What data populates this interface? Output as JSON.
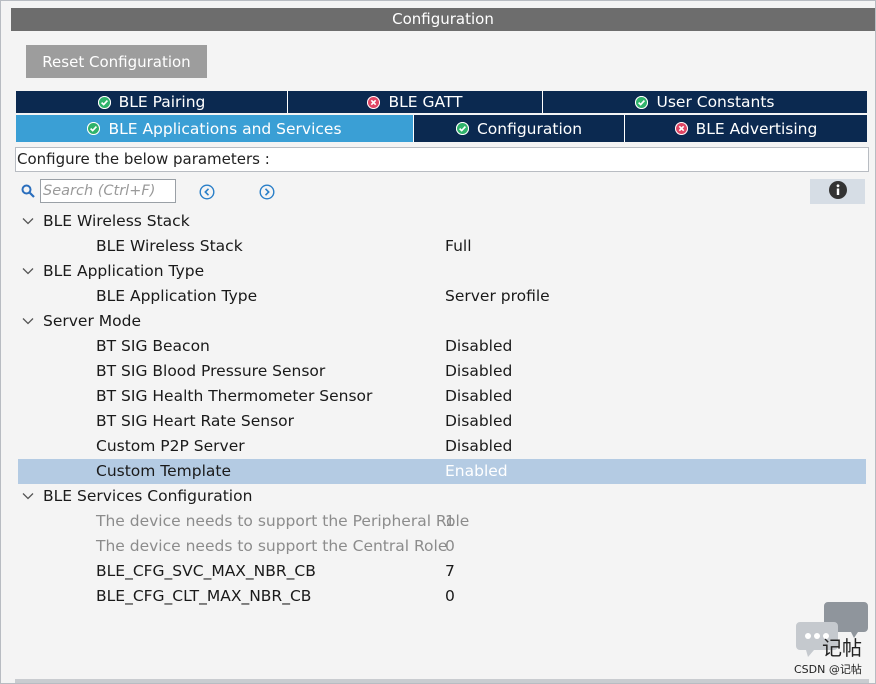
{
  "window": {
    "title": "Configuration"
  },
  "toolbar": {
    "reset_label": "Reset Configuration"
  },
  "tabs_row1": [
    {
      "label": "BLE Pairing",
      "status": "ok"
    },
    {
      "label": "BLE GATT",
      "status": "error"
    },
    {
      "label": "User Constants",
      "status": "ok"
    }
  ],
  "tabs_row2": [
    {
      "label": "BLE Applications and Services",
      "status": "ok",
      "active": true
    },
    {
      "label": "Configuration",
      "status": "ok"
    },
    {
      "label": "BLE Advertising",
      "status": "error"
    }
  ],
  "description": "Configure the below parameters :",
  "search": {
    "placeholder": "Search (Ctrl+F)"
  },
  "colors": {
    "tab_bg": "#0b2950",
    "tab_active": "#3a9fd5",
    "ok": "#2fb36b",
    "error": "#e04564",
    "selected_row": "#b4cbe3"
  },
  "groups": [
    {
      "label": "BLE Wireless Stack",
      "params": [
        {
          "label": "BLE Wireless Stack",
          "value": "Full"
        }
      ]
    },
    {
      "label": "BLE Application Type",
      "params": [
        {
          "label": "BLE Application Type",
          "value": "Server profile"
        }
      ]
    },
    {
      "label": "Server Mode",
      "params": [
        {
          "label": "BT SIG Beacon",
          "value": "Disabled"
        },
        {
          "label": "BT SIG Blood Pressure Sensor",
          "value": "Disabled"
        },
        {
          "label": "BT SIG Health Thermometer Sensor",
          "value": "Disabled"
        },
        {
          "label": "BT SIG Heart Rate Sensor",
          "value": "Disabled"
        },
        {
          "label": "Custom P2P Server",
          "value": "Disabled"
        },
        {
          "label": "Custom Template",
          "value": "Enabled",
          "selected": true
        }
      ]
    },
    {
      "label": "BLE Services Configuration",
      "params": [
        {
          "label": "The device needs to support the Peripheral Role",
          "value": "1",
          "disabled": true
        },
        {
          "label": "The device needs to support the Central Role",
          "value": "0",
          "disabled": true
        },
        {
          "label": "BLE_CFG_SVC_MAX_NBR_CB",
          "value": "7"
        },
        {
          "label": "BLE_CFG_CLT_MAX_NBR_CB",
          "value": "0"
        }
      ]
    }
  ],
  "watermark": {
    "line1": "记帖",
    "line2": "CSDN @记帖"
  }
}
